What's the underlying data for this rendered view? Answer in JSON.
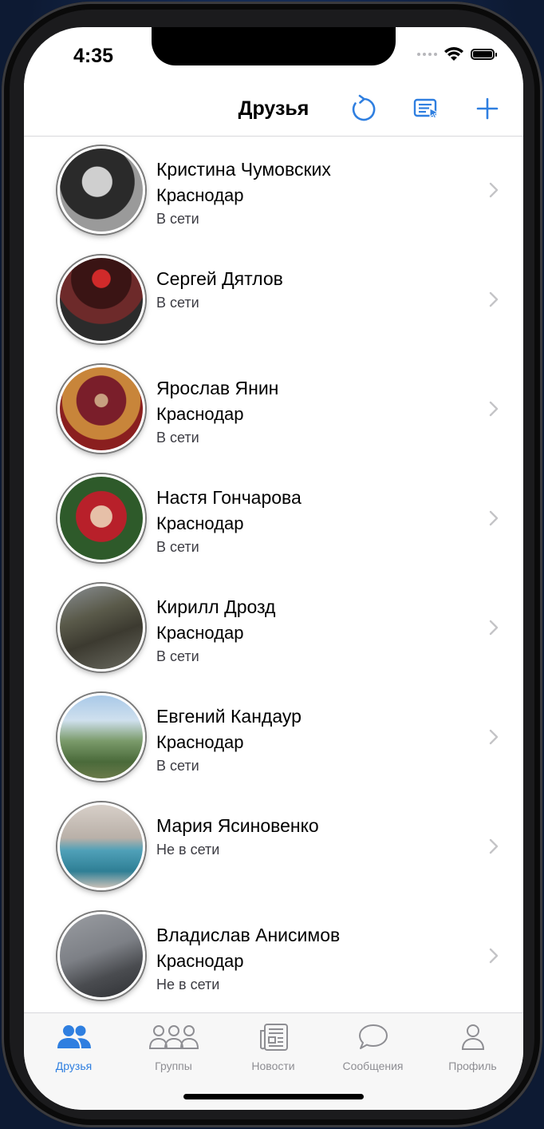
{
  "status_bar": {
    "time": "4:35"
  },
  "navbar": {
    "title": "Друзья",
    "icons": [
      "refresh-icon",
      "select-icon",
      "plus-icon"
    ]
  },
  "friends": [
    {
      "name": "Кристина Чумовских",
      "city": "Краснодар",
      "status": "В сети"
    },
    {
      "name": "Сергей Дятлов",
      "city": "",
      "status": "В сети"
    },
    {
      "name": "Ярослав Янин",
      "city": "Краснодар",
      "status": "В сети"
    },
    {
      "name": "Настя Гончарова",
      "city": "Краснодар",
      "status": "В сети"
    },
    {
      "name": "Кирилл Дрозд",
      "city": "Краснодар",
      "status": "В сети"
    },
    {
      "name": "Евгений Кандаур",
      "city": "Краснодар",
      "status": "В сети"
    },
    {
      "name": "Мария Ясиновенко",
      "city": "",
      "status": "Не в сети"
    },
    {
      "name": "Владислав Анисимов",
      "city": "Краснодар",
      "status": "Не в сети"
    }
  ],
  "tabbar": {
    "tabs": [
      {
        "label": "Друзья",
        "icon": "friends-icon",
        "active": true
      },
      {
        "label": "Группы",
        "icon": "groups-icon",
        "active": false
      },
      {
        "label": "Новости",
        "icon": "news-icon",
        "active": false
      },
      {
        "label": "Сообщения",
        "icon": "messages-icon",
        "active": false
      },
      {
        "label": "Профиль",
        "icon": "profile-icon",
        "active": false
      }
    ]
  },
  "colors": {
    "accent": "#2f7fe0",
    "inactive": "#8e8e93",
    "background": "#ffffff"
  }
}
